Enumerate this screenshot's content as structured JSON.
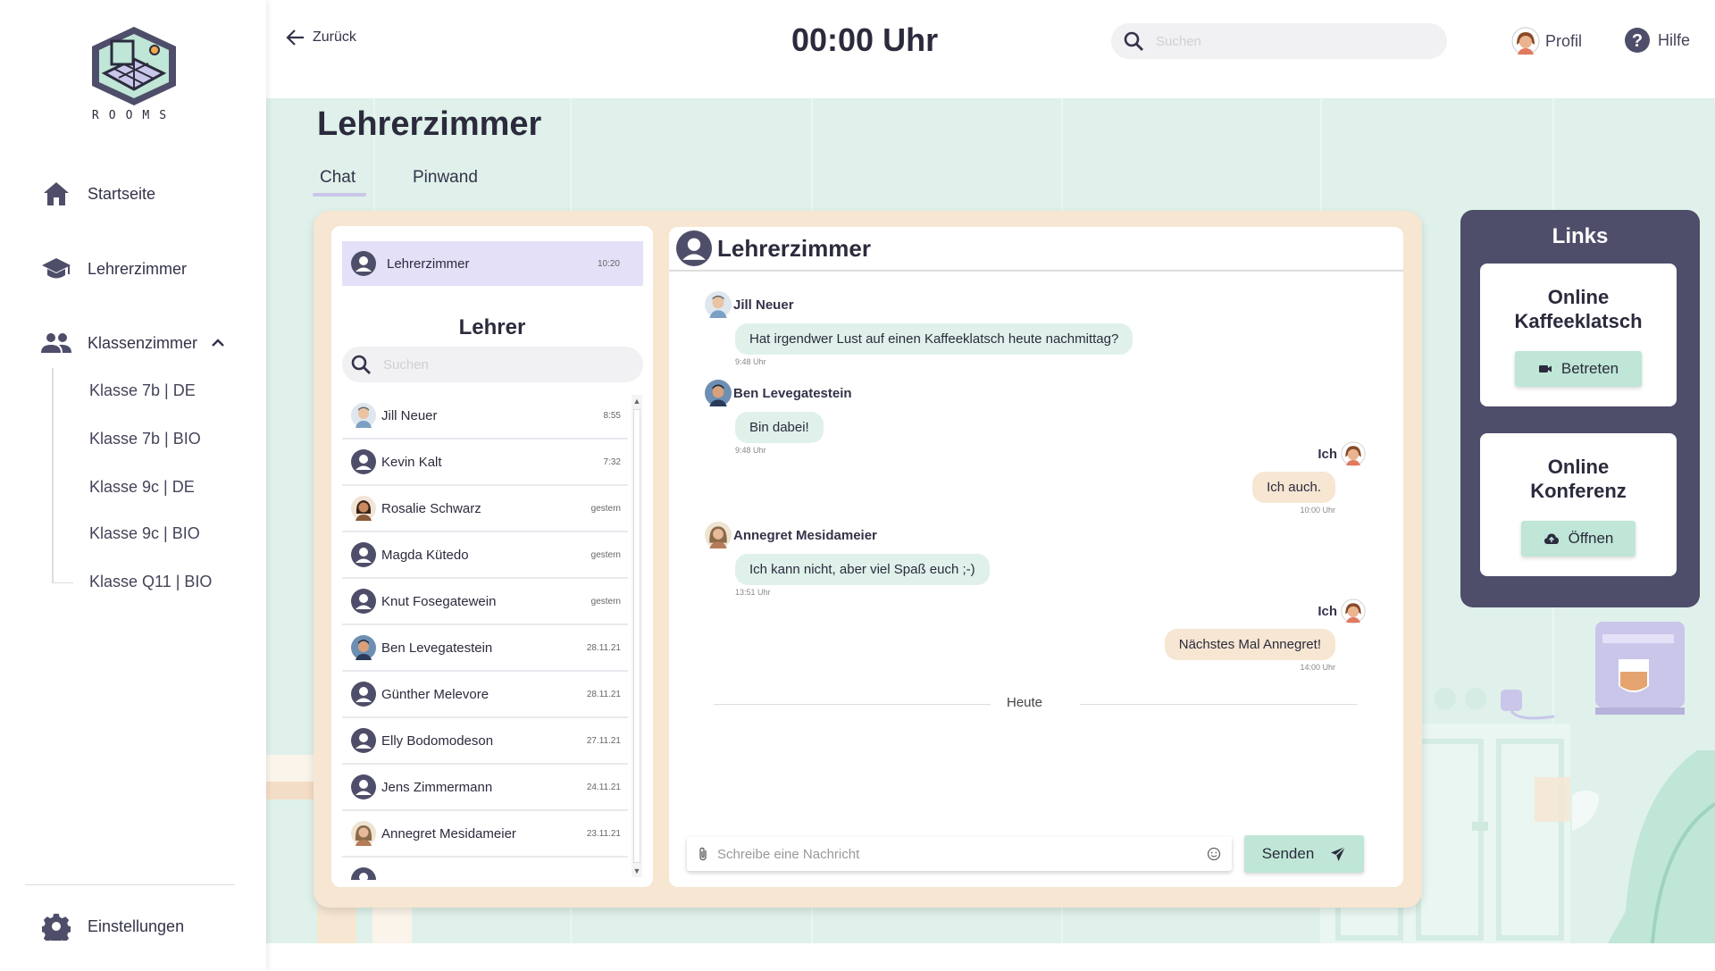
{
  "app": {
    "logo_text": "ROOMS"
  },
  "sidebar": {
    "items": [
      {
        "label": "Startseite",
        "icon": "home-icon"
      },
      {
        "label": "Lehrerzimmer",
        "icon": "graduation-cap-icon"
      },
      {
        "label": "Klassenzimmer",
        "icon": "people-icon"
      }
    ],
    "sub_items": [
      "Klasse 7b | DE",
      "Klasse 7b | BIO",
      "Klasse 9c | DE",
      "Klasse 9c | BIO",
      "Klasse Q11 | BIO"
    ],
    "settings_label": "Einstellungen"
  },
  "header": {
    "back_label": "Zurück",
    "clock": "00:00 Uhr",
    "search_placeholder": "Suchen",
    "profile_label": "Profil",
    "help_label": "Hilfe"
  },
  "page": {
    "title": "Lehrerzimmer",
    "tabs": [
      "Chat",
      "Pinwand"
    ]
  },
  "contacts": {
    "group": {
      "name": "Lehrerzimmer",
      "time": "10:20"
    },
    "section_title": "Lehrer",
    "search_placeholder": "Suchen",
    "list": [
      {
        "name": "Jill Neuer",
        "time": "8:55"
      },
      {
        "name": "Kevin Kalt",
        "time": "7:32"
      },
      {
        "name": "Rosalie Schwarz",
        "time": "gestern"
      },
      {
        "name": "Magda Küte­do",
        "time": "gestern"
      },
      {
        "name": "Knut Fosegatewein",
        "time": "gestern"
      },
      {
        "name": "Ben Levegatestein",
        "time": "28.11.21"
      },
      {
        "name": "Günther Melevore",
        "time": "28.11.21"
      },
      {
        "name": "Elly Bodomodeson",
        "time": "27.11.21"
      },
      {
        "name": "Jens Zimmermann",
        "time": "24.11.21"
      },
      {
        "name": "Annegret Mesidameier",
        "time": "23.11.21"
      }
    ]
  },
  "chat": {
    "title": "Lehrerzimmer",
    "messages": [
      {
        "author": "Jill Neuer",
        "text": "Hat irgendwer Lust auf einen Kaffeeklatsch heute nachmittag?",
        "time": "9:48 Uhr"
      },
      {
        "author": "Ben Levegatestein",
        "text": "Bin dabei!",
        "time": "9:48 Uhr"
      },
      {
        "author": "Ich",
        "text": "Ich auch.",
        "time": "10:00 Uhr"
      },
      {
        "author": "Annegret Mesidameier",
        "text": "Ich kann nicht, aber viel Spaß euch ;-)",
        "time": "13:51 Uhr"
      },
      {
        "author": "Ich",
        "text": "Nächstes Mal Annegret!",
        "time": "14:00 Uhr"
      }
    ],
    "day_separator": "Heute",
    "composer_placeholder": "Schreibe eine Nachricht",
    "send_label": "Senden"
  },
  "links": {
    "title": "Links",
    "cards": [
      {
        "title": "Online Kaffeeklatsch",
        "button": "Betreten",
        "icon": "video-camera-icon"
      },
      {
        "title": "Online Konferenz",
        "button": "Öffnen",
        "icon": "cloud-upload-icon"
      }
    ]
  },
  "colors": {
    "accent_mint": "#bfe6d6",
    "accent_peach": "#f6e6d2",
    "accent_lavender": "#e3e0f7",
    "dark_panel": "#4e4e6a"
  }
}
